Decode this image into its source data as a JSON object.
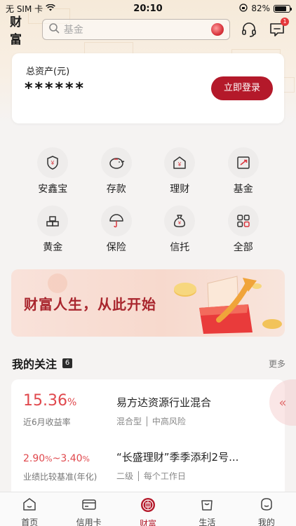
{
  "status_bar": {
    "carrier": "无 SIM 卡",
    "time": "20:10",
    "battery": "82%",
    "battery_level": 0.82
  },
  "header": {
    "title": "财富",
    "search_placeholder": "基金",
    "message_badge": "1"
  },
  "asset_card": {
    "label": "总资产(元)",
    "value": "******",
    "login_button": "立即登录"
  },
  "categories": [
    {
      "label": "安鑫宝",
      "icon": "shield-yen-icon"
    },
    {
      "label": "存款",
      "icon": "piggy-bank-icon"
    },
    {
      "label": "理财",
      "icon": "house-yen-icon"
    },
    {
      "label": "基金",
      "icon": "chart-up-icon"
    },
    {
      "label": "黄金",
      "icon": "gold-bars-icon"
    },
    {
      "label": "保险",
      "icon": "umbrella-icon"
    },
    {
      "label": "信托",
      "icon": "money-bag-icon"
    },
    {
      "label": "全部",
      "icon": "grid-icon"
    }
  ],
  "banner": {
    "text": "财富人生，从此开始"
  },
  "follow": {
    "title": "我的关注",
    "count": "6",
    "more": "更多",
    "items": [
      {
        "rate": "15.36",
        "rate_unit": "%",
        "rate_label": "近6月收益率",
        "name": "易方达资源行业混合",
        "tags": "混合型 │ 中高风险"
      },
      {
        "rate_low": "2.90",
        "rate_high": "3.40",
        "rate_unit": "%",
        "rate_sep": "~",
        "rate_label": "业绩比较基准(年化)",
        "name": "“长盛理财”季季添利2号...",
        "tags": "二级 │ 每个工作日"
      }
    ]
  },
  "tabbar": [
    {
      "label": "首页",
      "icon": "home-icon"
    },
    {
      "label": "信用卡",
      "icon": "credit-card-icon"
    },
    {
      "label": "财富",
      "icon": "wealth-coin-icon",
      "active": true
    },
    {
      "label": "生活",
      "icon": "shopping-bag-icon"
    },
    {
      "label": "我的",
      "icon": "profile-icon"
    }
  ],
  "colors": {
    "brand": "#b4192a",
    "rate": "#e0484d"
  }
}
